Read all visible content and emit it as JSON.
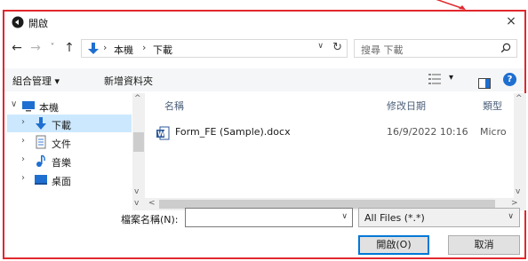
{
  "window": {
    "title": "開啟",
    "close_glyph": "×"
  },
  "nav": {
    "back": "←",
    "forward": "→",
    "recent": "˅",
    "up": "↑"
  },
  "address": {
    "crumbs": [
      "本機",
      "下載"
    ],
    "sep": "›",
    "dropdown": "∨",
    "refresh": "↻"
  },
  "search": {
    "placeholder": "搜尋 下載",
    "icon": "search-icon"
  },
  "toolbar": {
    "organize": "組合管理 ▾",
    "new_folder": "新增資料夾",
    "view_dd": "▾",
    "help": "?"
  },
  "sidebar": {
    "items": [
      {
        "label": "本機",
        "icon": "computer-icon",
        "chevron": "∨"
      },
      {
        "label": "下載",
        "icon": "download-icon",
        "chevron": "›"
      },
      {
        "label": "文件",
        "icon": "document-icon",
        "chevron": "›"
      },
      {
        "label": "音樂",
        "icon": "music-icon",
        "chevron": "›"
      },
      {
        "label": "桌面",
        "icon": "desktop-icon",
        "chevron": "›"
      }
    ],
    "selected_index": 1
  },
  "columns": [
    "名稱",
    "修改日期",
    "類型"
  ],
  "files": [
    {
      "name": "Form_FE (Sample).docx",
      "modified": "16/9/2022 10:16",
      "type": "Micro"
    }
  ],
  "footer": {
    "filename_label": "檔案名稱(N):",
    "filename_value": "",
    "filetype": "All Files (*.*)",
    "open_button": "開啟(O)",
    "cancel_button": "取消",
    "dd": "∨"
  },
  "scroll": {
    "up": "^",
    "down": "v",
    "left": "<",
    "right": ">"
  },
  "colors": {
    "annotation_red": "#e0282d",
    "accent": "#0078d7",
    "selected": "#cce8ff",
    "folder_blue": "#1f6fd1"
  }
}
